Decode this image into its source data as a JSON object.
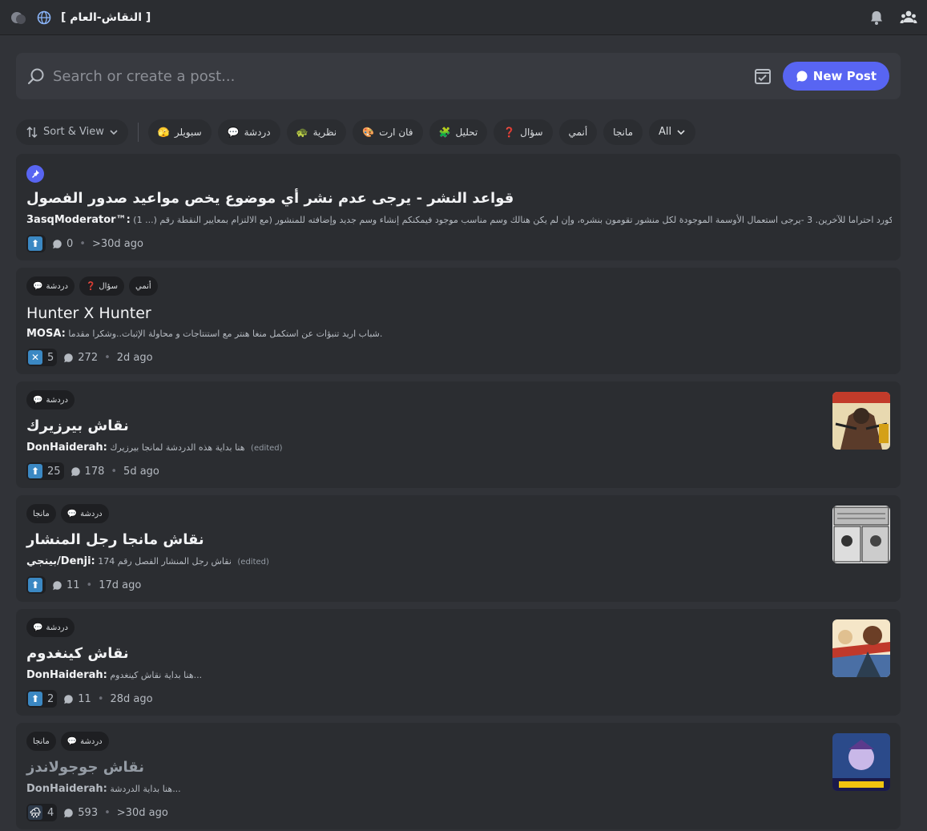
{
  "topbar": {
    "channel_title": "[ النقاش-العام ]",
    "icons": [
      "threads-icon",
      "globe-icon",
      "bell-icon",
      "members-icon"
    ]
  },
  "search": {
    "placeholder": "Search or create a post...",
    "new_post_label": "New Post"
  },
  "filters": {
    "sort_label": "Sort & View",
    "tags": [
      {
        "label": "سبويلر",
        "emoji": "🫣"
      },
      {
        "label": "دردشة",
        "emoji": "💬"
      },
      {
        "label": "نظرية",
        "emoji": "🐢"
      },
      {
        "label": "فان ارت",
        "emoji": "🎨"
      },
      {
        "label": "تحليل",
        "emoji": "🧩"
      },
      {
        "label": "سؤال",
        "emoji": "❓"
      },
      {
        "label": "أنمي",
        "emoji": ""
      },
      {
        "label": "مانجا",
        "emoji": ""
      },
      {
        "label": "All",
        "emoji": ""
      }
    ]
  },
  "posts": [
    {
      "pinned": true,
      "tags": [],
      "title": "قواعد النشر - يرجى عدم نشر أي موضوع يخص مواعيد صدور الفصول",
      "author": "3asqModerator™:",
      "preview": "(1 ...) الموجود في الديسكورد احتراما للآخرين. 3 -يرجى استعمال الأوسمة الموجودة لكل منشور تقومون بنشره، وإن لم يكن هنالك وسم مناسب موجود فيمكنكم إنشاء وسم جديد وإضافته للمنشور (مع الالتزام بمعايير النقطة رقم",
      "edited": "",
      "reaction": "up",
      "reaction_count": "",
      "comments": "0",
      "age": ">30d ago"
    },
    {
      "pinned": false,
      "tags": [
        {
          "label": "أنمي",
          "emoji": ""
        },
        {
          "label": "سؤال",
          "emoji": "❓"
        },
        {
          "label": "دردشة",
          "emoji": "💬"
        }
      ],
      "title": "Hunter X Hunter",
      "author": "MOSA:",
      "preview": "شباب اريد تنبؤات عن استكمل منغا هنتر مع استنتاجات و محاولة الإثبات..وشكرا مقدما.",
      "edited": "",
      "reaction": "x",
      "reaction_count": "5",
      "comments": "272",
      "age": "2d ago"
    },
    {
      "pinned": false,
      "tags": [
        {
          "label": "دردشة",
          "emoji": "💬"
        }
      ],
      "title": "نقاش بيرزيرك",
      "author": "DonHaiderah:",
      "preview": "هنا بداية هذه الدردشة لمانجا بيرزيرك",
      "edited": "(edited)",
      "reaction": "up",
      "reaction_count": "25",
      "comments": "178",
      "age": "5d ago"
    },
    {
      "pinned": false,
      "tags": [
        {
          "label": "دردشة",
          "emoji": "💬"
        },
        {
          "label": "مانجا",
          "emoji": ""
        }
      ],
      "title": "نقاش مانجا رجل المنشار",
      "author": "بينجي/Denji:",
      "preview": "نقاش رجل المنشار الفصل رقم 174",
      "edited": "(edited)",
      "reaction": "up",
      "reaction_count": "",
      "comments": "11",
      "age": "17d ago"
    },
    {
      "pinned": false,
      "tags": [
        {
          "label": "دردشة",
          "emoji": "💬"
        }
      ],
      "title": "نقاش كينغدوم",
      "author": "DonHaiderah:",
      "preview": "هنا بداية نقاش كينغدوم...",
      "edited": "",
      "reaction": "up",
      "reaction_count": "2",
      "comments": "11",
      "age": "28d ago"
    },
    {
      "pinned": false,
      "tags": [
        {
          "label": "دردشة",
          "emoji": "💬"
        },
        {
          "label": "مانجا",
          "emoji": ""
        }
      ],
      "title": "نقاش جوجولاندز",
      "author": "DonHaiderah:",
      "preview": "هنا بداية الدردشة...",
      "edited": "",
      "reaction": "cloud",
      "reaction_count": "4",
      "comments": "593",
      "age": ">30d ago"
    }
  ],
  "colors": {
    "background": "#313338",
    "card": "#2b2d31",
    "accent": "#5865f2"
  }
}
